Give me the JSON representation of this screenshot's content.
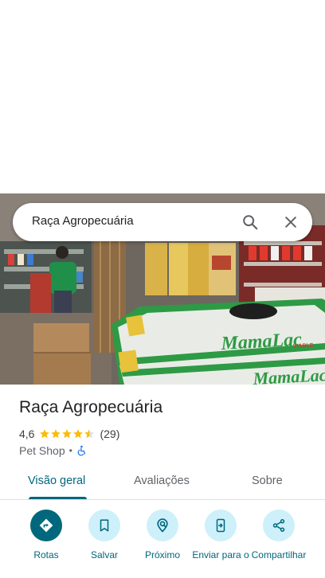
{
  "search": {
    "query": "Raça Agropecuária"
  },
  "photo": {
    "sack_brand": "MamaLac",
    "sack_sub": "VIABLE"
  },
  "place": {
    "name": "Raça Agropecuária",
    "rating": "4,6",
    "stars": 4.5,
    "review_count": "(29)",
    "category": "Pet Shop",
    "separator": "•"
  },
  "tabs": [
    {
      "label": "Visão geral",
      "active": true
    },
    {
      "label": "Avaliações",
      "active": false
    },
    {
      "label": "Sobre",
      "active": false
    }
  ],
  "actions": [
    {
      "label": "Rotas",
      "icon": "directions-icon"
    },
    {
      "label": "Salvar",
      "icon": "bookmark-icon"
    },
    {
      "label": "Próximo",
      "icon": "nearby-icon"
    },
    {
      "label": "Enviar para o",
      "icon": "send-to-phone-icon"
    },
    {
      "label": "Compartilhar",
      "icon": "share-icon"
    }
  ],
  "colors": {
    "accent": "#00677d",
    "action_bg": "#cdf0fa",
    "star": "#fbbc04",
    "accessible": "#1a73e8"
  }
}
